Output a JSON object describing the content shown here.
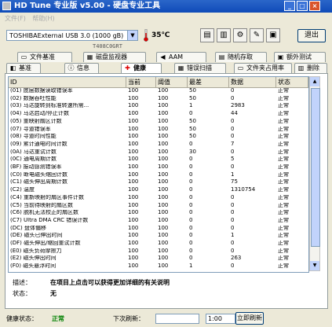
{
  "window": {
    "title": "HD Tune 专业版 v5.00 - 硬盘专业工具"
  },
  "menu": {
    "items": [
      "文件(F)",
      "帮助(H)"
    ]
  },
  "toolbar": {
    "drive": "TOSHIBAExternal USB 3.0 (1000 gB)",
    "temperature": "35℃",
    "serial": "T408C0GRT",
    "exit_label": "退出"
  },
  "tabs_top": [
    {
      "label": "文件基准",
      "icon": "file-icon"
    },
    {
      "label": "磁盘监视器",
      "icon": "monitor-icon"
    },
    {
      "label": "AAM",
      "icon": "speaker-icon"
    },
    {
      "label": "随机存取",
      "icon": "random-access-icon"
    },
    {
      "label": "额外测试",
      "icon": "extra-test-icon"
    }
  ],
  "tabs_bottom": [
    {
      "label": "基准",
      "icon": "benchmark-icon"
    },
    {
      "label": "信息",
      "icon": "info-icon"
    },
    {
      "label": "健康",
      "icon": "health-icon",
      "active": true
    },
    {
      "label": "错误扫描",
      "icon": "error-scan-icon"
    },
    {
      "label": "文件夹占用率",
      "icon": "folder-usage-icon"
    },
    {
      "label": "删除",
      "icon": "erase-icon"
    }
  ],
  "health_table": {
    "headers": {
      "id": "ID",
      "current": "当前",
      "threshold": "阈值",
      "worst": "最差",
      "data": "数据",
      "status": "状态"
    },
    "rows": [
      {
        "id": "(01) 底层数据读取错误率",
        "current": "100",
        "threshold": "100",
        "worst": "50",
        "data": "0",
        "status": "正常"
      },
      {
        "id": "(02) 数据吞吐性能",
        "current": "100",
        "threshold": "100",
        "worst": "50",
        "data": "0",
        "status": "正常"
      },
      {
        "id": "(03) 马达旋转到标准转速所需...",
        "current": "100",
        "threshold": "100",
        "worst": "1",
        "data": "2983",
        "status": "正常"
      },
      {
        "id": "(04) 马达启动/停止计数",
        "current": "100",
        "threshold": "100",
        "worst": "0",
        "data": "44",
        "status": "正常"
      },
      {
        "id": "(05) 重映射扇区计数",
        "current": "100",
        "threshold": "100",
        "worst": "50",
        "data": "0",
        "status": "正常"
      },
      {
        "id": "(07) 寻道错误率",
        "current": "100",
        "threshold": "100",
        "worst": "50",
        "data": "0",
        "status": "正常"
      },
      {
        "id": "(08) 寻道时间性能",
        "current": "100",
        "threshold": "100",
        "worst": "50",
        "data": "0",
        "status": "正常"
      },
      {
        "id": "(09) 累计通电时间计数",
        "current": "100",
        "threshold": "100",
        "worst": "0",
        "data": "7",
        "status": "正常"
      },
      {
        "id": "(0A) 马达重试计数",
        "current": "100",
        "threshold": "100",
        "worst": "30",
        "data": "0",
        "status": "正常"
      },
      {
        "id": "(0C) 通电周期计数",
        "current": "100",
        "threshold": "100",
        "worst": "0",
        "data": "5",
        "status": "正常"
      },
      {
        "id": "(BF) 振动感测错误率",
        "current": "100",
        "threshold": "100",
        "worst": "0",
        "data": "0",
        "status": "正常"
      },
      {
        "id": "(C0) 断电磁头缩回计数",
        "current": "100",
        "threshold": "100",
        "worst": "0",
        "data": "1",
        "status": "正常"
      },
      {
        "id": "(C1) 磁头伸出周期计数",
        "current": "100",
        "threshold": "100",
        "worst": "0",
        "data": "75",
        "status": "正常"
      },
      {
        "id": "(C2) 温度",
        "current": "100",
        "threshold": "100",
        "worst": "0",
        "data": "1310754",
        "status": "正常"
      },
      {
        "id": "(C4) 重新映射的扇区事件计数",
        "current": "100",
        "threshold": "100",
        "worst": "0",
        "data": "0",
        "status": "正常"
      },
      {
        "id": "(C5) 当前待映射的扇区数",
        "current": "100",
        "threshold": "100",
        "worst": "0",
        "data": "0",
        "status": "正常"
      },
      {
        "id": "(C6) 脱机无法校正的扇区数",
        "current": "100",
        "threshold": "100",
        "worst": "0",
        "data": "0",
        "status": "正常"
      },
      {
        "id": "(C7) Ultra DMA CRC 错误计数",
        "current": "100",
        "threshold": "100",
        "worst": "0",
        "data": "0",
        "status": "正常"
      },
      {
        "id": "(DC) 盘体偏移",
        "current": "100",
        "threshold": "100",
        "worst": "0",
        "data": "0",
        "status": "正常"
      },
      {
        "id": "(DE) 磁头已伸出时间",
        "current": "100",
        "threshold": "100",
        "worst": "0",
        "data": "1",
        "status": "正常"
      },
      {
        "id": "(DF) 磁头伸出/缩回重试计数",
        "current": "100",
        "threshold": "100",
        "worst": "0",
        "data": "0",
        "status": "正常"
      },
      {
        "id": "(E0) 磁头负荷摩擦力",
        "current": "100",
        "threshold": "100",
        "worst": "0",
        "data": "0",
        "status": "正常"
      },
      {
        "id": "(E2) 磁头伸出时间",
        "current": "100",
        "threshold": "100",
        "worst": "0",
        "data": "263",
        "status": "正常"
      },
      {
        "id": "(F0) 磁头悬浮时间",
        "current": "100",
        "threshold": "100",
        "worst": "1",
        "data": "0",
        "status": "正常"
      }
    ]
  },
  "description": {
    "label": "描述：",
    "value": "在项目上点击可以获得更加详细的有关说明",
    "status_label": "状态：",
    "status_value": "无"
  },
  "status_bar": {
    "health_label": "健康状态：",
    "health_value": "正常",
    "refresh_label": "下次刷新：",
    "interval": "1:00",
    "refresh_button": "立即刷新"
  },
  "colors": {
    "titlebar": "#0F4BB8",
    "status_ok": "#008000"
  }
}
